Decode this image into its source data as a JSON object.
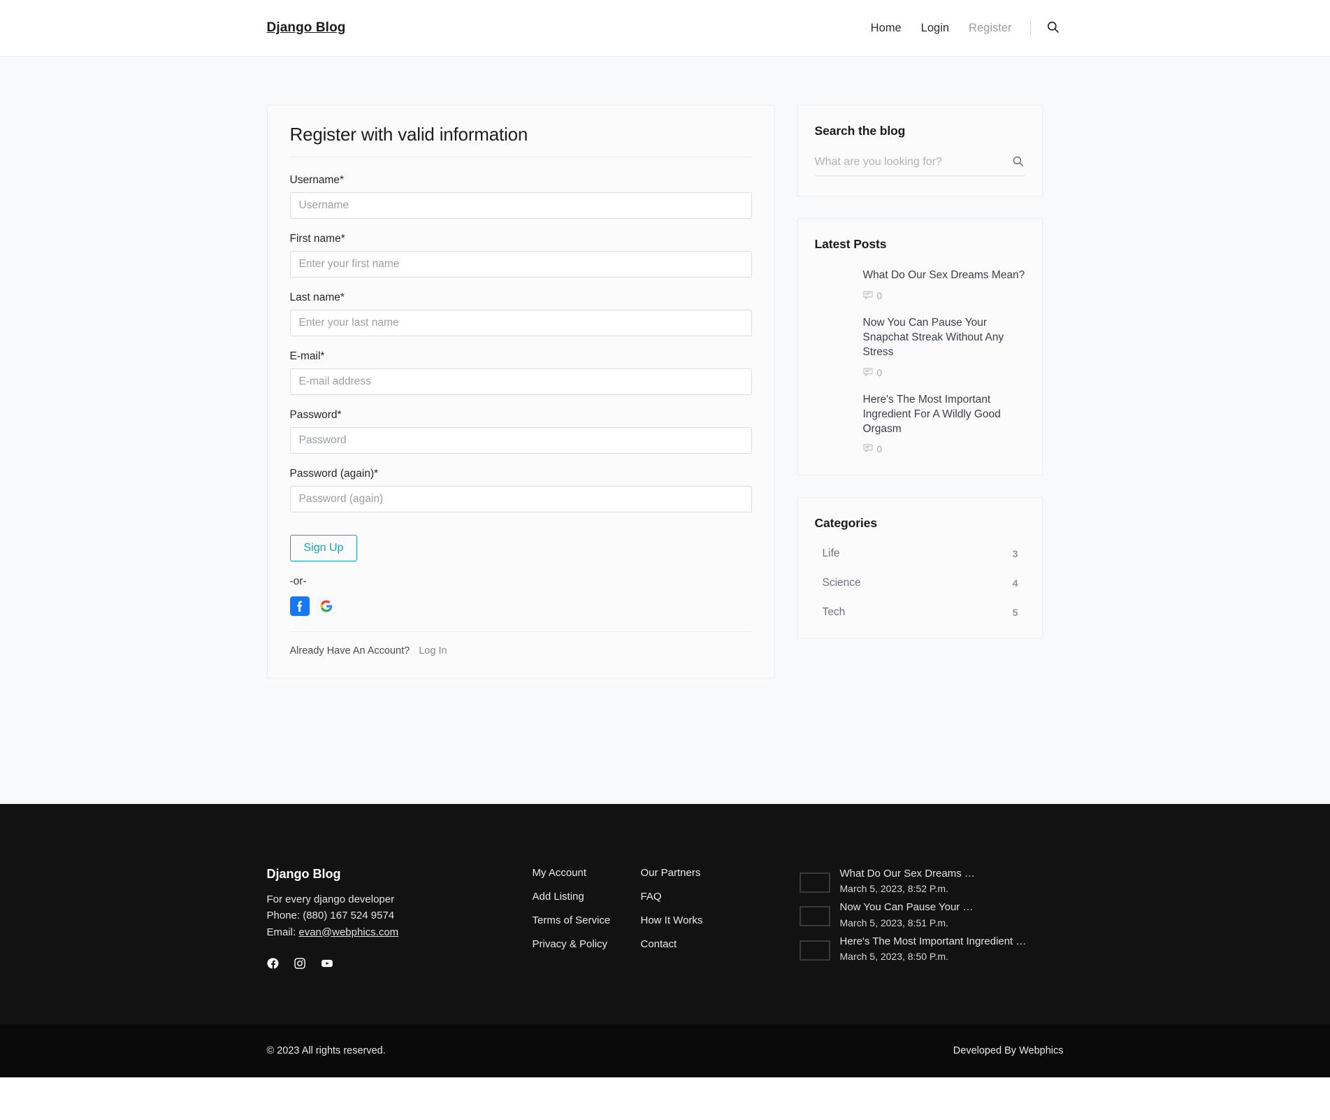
{
  "header": {
    "brand": "Django Blog",
    "nav": [
      {
        "label": "Home",
        "active": false
      },
      {
        "label": "Login",
        "active": false
      },
      {
        "label": "Register",
        "active": true
      }
    ],
    "search_icon": "search-icon"
  },
  "register": {
    "title": "Register with valid information",
    "fields": [
      {
        "label": "Username*",
        "placeholder": "Username",
        "value": "",
        "type": "text",
        "name": "username"
      },
      {
        "label": "First name*",
        "placeholder": "Enter your first name",
        "value": "",
        "type": "text",
        "name": "first-name"
      },
      {
        "label": "Last name*",
        "placeholder": "Enter your last name",
        "value": "",
        "type": "text",
        "name": "last-name"
      },
      {
        "label": "E-mail*",
        "placeholder": "E-mail address",
        "value": "",
        "type": "email",
        "name": "email"
      },
      {
        "label": "Password*",
        "placeholder": "Password",
        "value": "",
        "type": "password",
        "name": "password"
      },
      {
        "label": "Password (again)*",
        "placeholder": "Password (again)",
        "value": "",
        "type": "password",
        "name": "password-again"
      }
    ],
    "submit_label": "Sign Up",
    "or_text": "-or-",
    "social": [
      {
        "name": "facebook-login-icon",
        "color": "#1877f2"
      },
      {
        "name": "google-login-icon",
        "color": "#ffffff"
      }
    ],
    "already_text": "Already Have An Account?",
    "login_link": "Log In",
    "accent_color": "#17a2b8"
  },
  "sidebar": {
    "search": {
      "title": "Search the blog",
      "placeholder": "What are you looking for?",
      "value": "",
      "icon": "search-icon"
    },
    "latest": {
      "title": "Latest Posts",
      "posts": [
        {
          "title": "What Do Our Sex Dreams Mean?",
          "comments": "0",
          "thumb": "th-dream"
        },
        {
          "title": "Now You Can Pause Your Snapchat Streak Without Any Stress",
          "comments": "0",
          "thumb": "th-snap"
        },
        {
          "title": "Here's The Most Important Ingredient For A Wildly Good Orgasm",
          "comments": "0",
          "thumb": "th-orgasm"
        }
      ]
    },
    "categories": {
      "title": "Categories",
      "items": [
        {
          "name": "Life",
          "count": "3"
        },
        {
          "name": "Science",
          "count": "4"
        },
        {
          "name": "Tech",
          "count": "5"
        }
      ]
    }
  },
  "footer": {
    "brand": "Django Blog",
    "tagline": "For every django developer",
    "phone": "Phone: (880) 167 524 9574",
    "email_label": "Email:",
    "email": "evan@webphics.com",
    "social": [
      {
        "name": "facebook-icon"
      },
      {
        "name": "instagram-icon"
      },
      {
        "name": "youtube-icon"
      }
    ],
    "links_col1": [
      "My Account",
      "Add Listing",
      "Terms of Service",
      "Privacy & Policy"
    ],
    "links_col2": [
      "Our Partners",
      "FAQ",
      "How It Works",
      "Contact"
    ],
    "posts": [
      {
        "title": "What Do Our Sex Dreams …",
        "date": "March 5, 2023, 8:52 P.m.",
        "thumb": "th-dream"
      },
      {
        "title": "Now You Can Pause Your …",
        "date": "March 5, 2023, 8:51 P.m.",
        "thumb": "th-snap"
      },
      {
        "title": "Here's The Most Important Ingredient …",
        "date": "March 5, 2023, 8:50 P.m.",
        "thumb": "th-orgasm"
      }
    ],
    "copyright": "© 2023 All rights reserved.",
    "developed_by": "Developed By Webphics"
  }
}
